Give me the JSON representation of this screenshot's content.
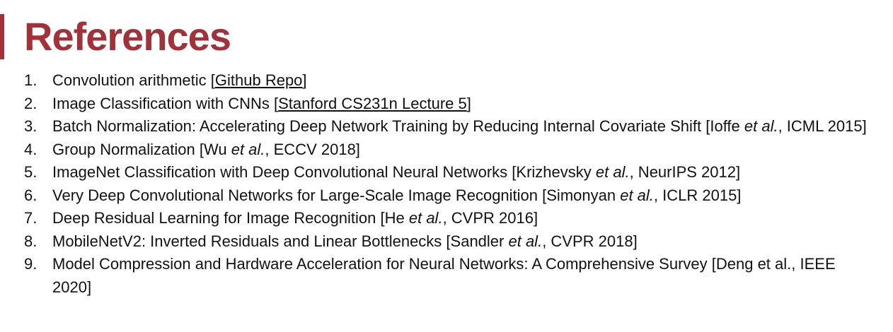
{
  "title": "References",
  "accent_color": "#a3313a",
  "references": [
    {
      "num": "1.",
      "parts": [
        {
          "t": "text",
          "v": "Convolution arithmetic ["
        },
        {
          "t": "link",
          "v": "Github Repo"
        },
        {
          "t": "text",
          "v": "]"
        }
      ]
    },
    {
      "num": "2.",
      "parts": [
        {
          "t": "text",
          "v": "Image Classification with CNNs ["
        },
        {
          "t": "link",
          "v": "Stanford CS231n Lecture 5"
        },
        {
          "t": "text",
          "v": "]"
        }
      ]
    },
    {
      "num": "3.",
      "parts": [
        {
          "t": "text",
          "v": "Batch Normalization: Accelerating Deep Network Training by Reducing Internal Covariate Shift [Ioffe "
        },
        {
          "t": "em",
          "v": "et al."
        },
        {
          "t": "text",
          "v": ", ICML 2015]"
        }
      ]
    },
    {
      "num": "4.",
      "parts": [
        {
          "t": "text",
          "v": "Group Normalization [Wu "
        },
        {
          "t": "em",
          "v": "et al."
        },
        {
          "t": "text",
          "v": ", ECCV 2018]"
        }
      ]
    },
    {
      "num": "5.",
      "parts": [
        {
          "t": "text",
          "v": "ImageNet Classification with Deep Convolutional Neural Networks [Krizhevsky "
        },
        {
          "t": "em",
          "v": "et al."
        },
        {
          "t": "text",
          "v": ", NeurIPS 2012]"
        }
      ]
    },
    {
      "num": "6.",
      "parts": [
        {
          "t": "text",
          "v": "Very Deep Convolutional Networks for Large-Scale Image Recognition [Simonyan "
        },
        {
          "t": "em",
          "v": "et al."
        },
        {
          "t": "text",
          "v": ", ICLR 2015]"
        }
      ]
    },
    {
      "num": "7.",
      "parts": [
        {
          "t": "text",
          "v": "Deep Residual Learning for Image Recognition [He "
        },
        {
          "t": "em",
          "v": "et al."
        },
        {
          "t": "text",
          "v": ", CVPR 2016]"
        }
      ]
    },
    {
      "num": "8.",
      "parts": [
        {
          "t": "text",
          "v": "MobileNetV2: Inverted Residuals and Linear Bottlenecks [Sandler "
        },
        {
          "t": "em",
          "v": "et al."
        },
        {
          "t": "text",
          "v": ", CVPR 2018]"
        }
      ]
    },
    {
      "num": "9.",
      "parts": [
        {
          "t": "text",
          "v": "Model Compression and Hardware Acceleration for Neural Networks: A Comprehensive Survey [Deng et al., IEEE 2020]"
        }
      ]
    }
  ]
}
